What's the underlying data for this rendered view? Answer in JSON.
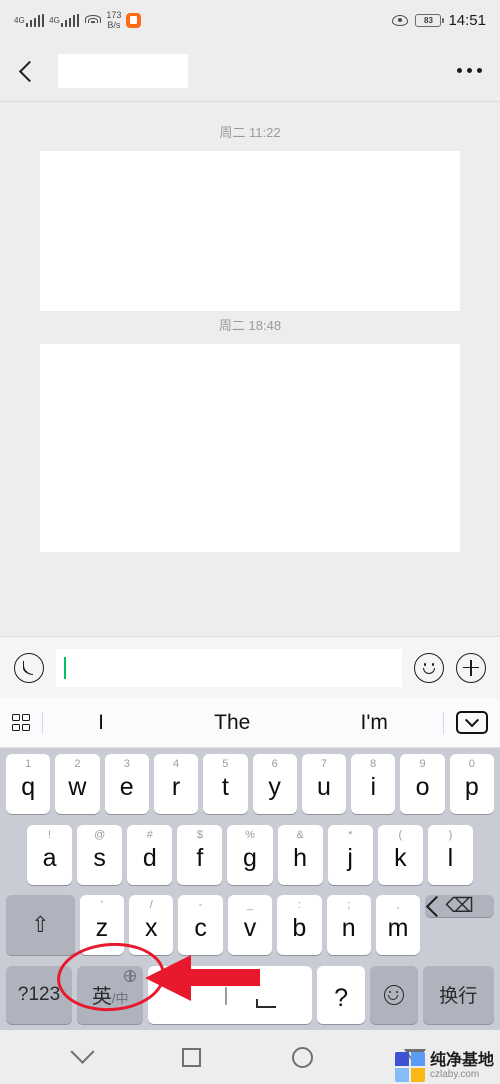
{
  "status_bar": {
    "network_label_1": "4G",
    "network_label_2": "4G",
    "data_speed": "173",
    "data_speed_unit": "B/s",
    "battery_percent": "83",
    "time": "14:51"
  },
  "header": {
    "contact_name": "",
    "back_label": "Back",
    "more_label": "More"
  },
  "conversation": {
    "messages": [
      {
        "timestamp": "周二 11:22",
        "content": ""
      },
      {
        "timestamp": "周二 18:48",
        "content": ""
      }
    ]
  },
  "input_bar": {
    "voice_label": "Voice",
    "text_value": "",
    "placeholder": "",
    "emoji_label": "Emoji",
    "more_label": "More"
  },
  "suggestions": {
    "grid_label": "Panel",
    "words": [
      "I",
      "The",
      "I'm"
    ],
    "hide_label": "Hide keyboard"
  },
  "keyboard": {
    "row1": [
      {
        "main": "q",
        "hint": "1"
      },
      {
        "main": "w",
        "hint": "2"
      },
      {
        "main": "e",
        "hint": "3"
      },
      {
        "main": "r",
        "hint": "4"
      },
      {
        "main": "t",
        "hint": "5"
      },
      {
        "main": "y",
        "hint": "6"
      },
      {
        "main": "u",
        "hint": "7"
      },
      {
        "main": "i",
        "hint": "8"
      },
      {
        "main": "o",
        "hint": "9"
      },
      {
        "main": "p",
        "hint": "0"
      }
    ],
    "row2": [
      {
        "main": "a",
        "hint": "!"
      },
      {
        "main": "s",
        "hint": "@"
      },
      {
        "main": "d",
        "hint": "#"
      },
      {
        "main": "f",
        "hint": "$"
      },
      {
        "main": "g",
        "hint": "%"
      },
      {
        "main": "h",
        "hint": "&"
      },
      {
        "main": "j",
        "hint": "*"
      },
      {
        "main": "k",
        "hint": "("
      },
      {
        "main": "l",
        "hint": ")"
      }
    ],
    "row3": [
      {
        "main": "z",
        "hint": "'"
      },
      {
        "main": "x",
        "hint": "/"
      },
      {
        "main": "c",
        "hint": "-"
      },
      {
        "main": "v",
        "hint": "_"
      },
      {
        "main": "b",
        "hint": ":"
      },
      {
        "main": "n",
        "hint": ";"
      },
      {
        "main": "m",
        "hint": ","
      }
    ],
    "shift_glyph": "⇧",
    "backspace_glyph": "⌫",
    "symbols_key": "?123",
    "lang_key_primary": "英",
    "lang_key_separator": "/",
    "lang_key_secondary": "中",
    "lang_key_globe": "globe-icon",
    "space_key": "",
    "question_key": "?",
    "emoji_key": "emoji-icon",
    "enter_key": "换行"
  },
  "annotation": {
    "highlight_target": "英/中",
    "ellipse_color": "#e8192c",
    "arrow_color": "#e8192c"
  },
  "nav_bar": {
    "chevron_label": "Collapse",
    "recents_label": "Recents",
    "home_label": "Home",
    "back_label": "Back"
  },
  "watermark": {
    "name_cn": "纯净基地",
    "name_en": "czlaby.com"
  },
  "colors": {
    "app_background": "#ededed",
    "keyboard_background": "#c9ccd4",
    "key_white": "#ffffff",
    "key_gray": "#aeb3bd",
    "cursor_green": "#07c160",
    "accent_red": "#e8192c",
    "app_icon_orange": "#ff6a13"
  }
}
